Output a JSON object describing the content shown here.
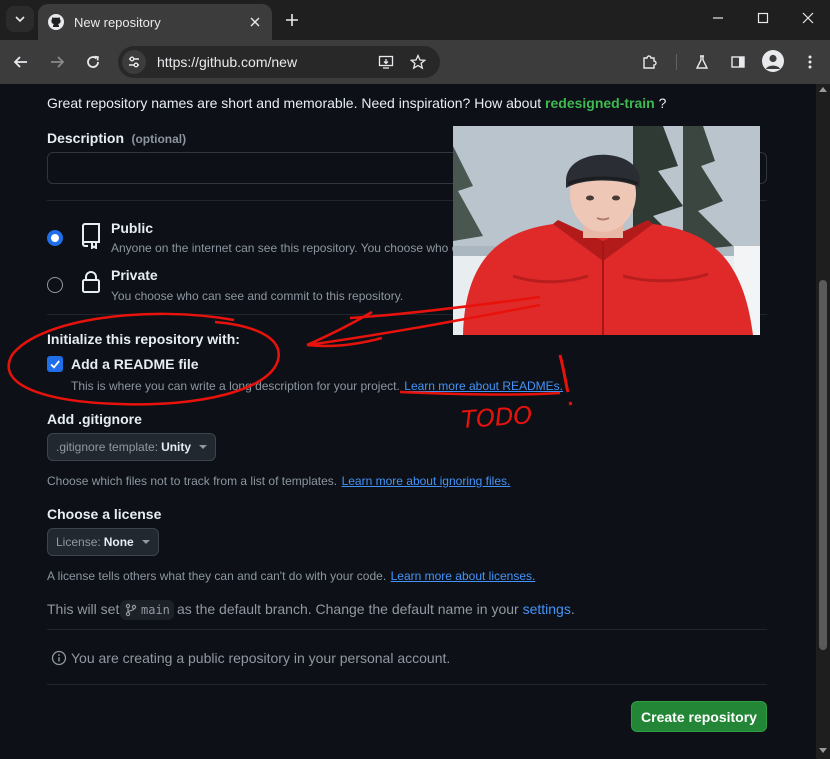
{
  "browser": {
    "tab_title": "New repository",
    "url": "https://github.com/new"
  },
  "page": {
    "name_hint_text": "Great repository names are short and memorable. Need inspiration? How about",
    "name_suggestion": "redesigned-train",
    "name_hint_end": "?",
    "description": {
      "label": "Description",
      "optional": "(optional)",
      "value": ""
    },
    "visibility": {
      "public": {
        "label": "Public",
        "desc": "Anyone on the internet can see this repository. You choose who c",
        "selected": true
      },
      "private": {
        "label": "Private",
        "desc": "You choose who can see and commit to this repository.",
        "selected": false
      }
    },
    "init": {
      "heading": "Initialize this repository with:",
      "readme_label": "Add a README file",
      "readme_checked": true,
      "readme_desc": "This is where you can write a long description for your project.",
      "readme_link": "Learn more about READMEs."
    },
    "gitignore": {
      "heading": "Add .gitignore",
      "select_label": ".gitignore template:",
      "select_value": "Unity",
      "desc": "Choose which files not to track from a list of templates.",
      "link": "Learn more about ignoring files."
    },
    "license": {
      "heading": "Choose a license",
      "select_label": "License:",
      "select_value": "None",
      "desc": "A license tells others what they can and can't do with your code.",
      "link": "Learn more about licenses."
    },
    "branch": {
      "prefix": "This will set",
      "name": "main",
      "suffix": "as the default branch. Change the default name in your",
      "settings_link": "settings",
      "end": "."
    },
    "notice": "You are creating a public repository in your personal account.",
    "create_button": "Create repository"
  },
  "annotations": {
    "handwritten": "TODO",
    "color": "#e8120c"
  },
  "colors": {
    "page_bg": "#0d1117",
    "accent_green": "#238636",
    "link_blue": "#4493f8",
    "suggest_green": "#3fb950"
  }
}
